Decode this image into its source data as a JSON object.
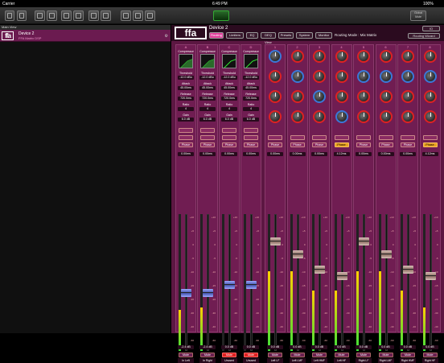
{
  "status": {
    "carrier": "Carrier",
    "time": "6:49 PM",
    "battery": "100%"
  },
  "toolbar": {
    "center_icon": "mixer-logo-icon",
    "global_mute": "Global\nMute"
  },
  "left": {
    "header": "Main View",
    "device": {
      "logo": "ffa",
      "name": "Device 2",
      "model": "FFA Matrix DSP"
    }
  },
  "right": {
    "logo": "ffa",
    "device_name": "Device 2",
    "view": "View",
    "io": "IO",
    "routing_mode": "Routing Mode : Mix Matrix",
    "routing_wizard": "Routing Wizard",
    "tabs": [
      "Routing",
      "Limiters",
      "EQ",
      "DEQ",
      "Presets",
      "System",
      "Monitor"
    ],
    "active_tab": 0
  },
  "inputs": [
    {
      "num": "A",
      "threshold": "-12.0 dBu",
      "attack": "45.00ms",
      "release": "720.0ms",
      "ratio": "4",
      "gain": "6.0 dB",
      "delay": "0.00ms",
      "level": "-2.4 dB",
      "out": "In Left",
      "mute": "Mute",
      "muted": false,
      "fader": 0.42,
      "meter": 0.3,
      "delay_on": false
    },
    {
      "num": "B",
      "threshold": "-12.0 dBu",
      "attack": "45.00ms",
      "release": "720.0ms",
      "ratio": "4",
      "gain": "6.0 dB",
      "delay": "0.00ms",
      "level": "-2.4 dB",
      "out": "In Right",
      "mute": "Mute",
      "muted": false,
      "fader": 0.42,
      "meter": 0.32,
      "delay_on": false
    },
    {
      "num": "C",
      "threshold": "-12.0 dBu",
      "attack": "45.00ms",
      "release": "720.0ms",
      "ratio": "4",
      "gain": "6.0 dB",
      "delay": "0.00ms",
      "level": "0.0 dB",
      "out": "Unused",
      "mute": "Mute",
      "muted": true,
      "fader": 0.48,
      "meter": 0.0,
      "delay_on": false
    },
    {
      "num": "D",
      "threshold": "-12.0 dBu",
      "attack": "45.00ms",
      "release": "720.0ms",
      "ratio": "4",
      "gain": "6.0 dB",
      "delay": "0.00ms",
      "level": "0.0 dB",
      "out": "Unused",
      "mute": "Mute",
      "muted": true,
      "fader": 0.48,
      "meter": 0.0,
      "delay_on": false
    }
  ],
  "outputs": [
    {
      "num": "1",
      "delay": "0.00ms",
      "level": "0.0 dB",
      "out": "Left LF",
      "mute": "Mute",
      "fader": 0.82,
      "meter": 0.58,
      "knobs": [
        "blue",
        "red",
        "red",
        "red"
      ],
      "delay_on": false
    },
    {
      "num": "2",
      "delay": "0.00ms",
      "level": "0.0 dB",
      "out": "Left LMF",
      "mute": "Mute",
      "fader": 0.72,
      "meter": 0.58,
      "knobs": [
        "red",
        "blue",
        "red",
        "red"
      ],
      "delay_on": false
    },
    {
      "num": "3",
      "delay": "0.00ms",
      "level": "0.0 dB",
      "out": "Left HMF",
      "mute": "Mute",
      "fader": 0.6,
      "meter": 0.44,
      "knobs": [
        "red",
        "red",
        "blue",
        "red"
      ],
      "delay_on": false
    },
    {
      "num": "4",
      "delay": "4.12ms",
      "level": "0.0 dB",
      "out": "Left HF",
      "mute": "Mute",
      "fader": 0.55,
      "meter": 0.44,
      "knobs": [
        "red",
        "red",
        "red",
        "blue"
      ],
      "delay_on": true
    },
    {
      "num": "5",
      "delay": "0.00ms",
      "level": "0.0 dB",
      "out": "Right LF",
      "mute": "Mute",
      "fader": 0.82,
      "meter": 0.58,
      "knobs": [
        "red",
        "blue",
        "red",
        "red"
      ],
      "delay_on": false
    },
    {
      "num": "6",
      "delay": "0.00ms",
      "level": "0.0 dB",
      "out": "Right LMF",
      "mute": "Mute",
      "fader": 0.72,
      "meter": 0.58,
      "knobs": [
        "red",
        "blue",
        "red",
        "red"
      ],
      "delay_on": false
    },
    {
      "num": "7",
      "delay": "0.00ms",
      "level": "0.0 dB",
      "out": "Right HMF",
      "mute": "Mute",
      "fader": 0.6,
      "meter": 0.44,
      "knobs": [
        "red",
        "blue",
        "red",
        "red"
      ],
      "delay_on": false
    },
    {
      "num": "8",
      "delay": "4.12ms",
      "level": "0.0 dB",
      "out": "Right HF",
      "mute": "Mute",
      "fader": 0.55,
      "meter": 0.32,
      "knobs": [
        "red",
        "blue",
        "red",
        "red"
      ],
      "delay_on": true
    }
  ],
  "labels": {
    "compressor": "Compressor",
    "threshold": "Threshold",
    "attack": "Attack",
    "release": "Release",
    "ratio": "Ratio",
    "gain": "Gain",
    "phase": "Phase",
    "input_unused": "Unused"
  },
  "scale": [
    "+10",
    "+5",
    "0",
    "-5",
    "-10",
    "-15",
    "-20",
    "-30",
    "-40",
    "-60"
  ]
}
